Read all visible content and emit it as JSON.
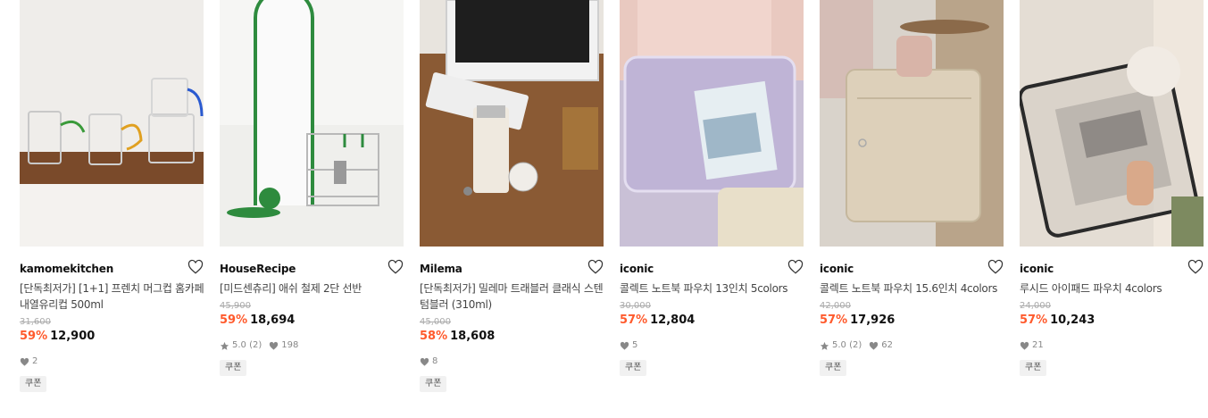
{
  "products": [
    {
      "brand": "kamomekitchen",
      "title": "[단독최저가] [1+1] 프렌치 머그컵 홈카페 내열유리컵 500ml",
      "original_price": "31,600",
      "discount": "59%",
      "price": "12,900",
      "rating": "",
      "reviews": "",
      "likes": "2",
      "coupon": "쿠폰"
    },
    {
      "brand": "HouseRecipe",
      "title": "[미드센츄리] 애쉬 철제 2단 선반",
      "original_price": "45,900",
      "discount": "59%",
      "price": "18,694",
      "rating": "5.0",
      "reviews": "(2)",
      "likes": "198",
      "coupon": "쿠폰"
    },
    {
      "brand": "Milema",
      "title": "[단독최저가] 밀레마 트래블러 클래식 스텐 텀블러 (310ml)",
      "original_price": "45,000",
      "discount": "58%",
      "price": "18,608",
      "rating": "",
      "reviews": "",
      "likes": "8",
      "coupon": "쿠폰"
    },
    {
      "brand": "iconic",
      "title": "콜렉트 노트북 파우치 13인치 5colors",
      "original_price": "30,000",
      "discount": "57%",
      "price": "12,804",
      "rating": "",
      "reviews": "",
      "likes": "5",
      "coupon": "쿠폰"
    },
    {
      "brand": "iconic",
      "title": "콜렉트 노트북 파우치 15.6인치 4colors",
      "original_price": "42,000",
      "discount": "57%",
      "price": "17,926",
      "rating": "5.0",
      "reviews": "(2)",
      "likes": "62",
      "coupon": "쿠폰"
    },
    {
      "brand": "iconic",
      "title": "루시드 아이패드 파우치 4colors",
      "original_price": "24,000",
      "discount": "57%",
      "price": "10,243",
      "rating": "",
      "reviews": "",
      "likes": "21",
      "coupon": "쿠폰"
    }
  ],
  "colors": {
    "discount": "#ff5a2c",
    "icon_gray": "#888888"
  }
}
